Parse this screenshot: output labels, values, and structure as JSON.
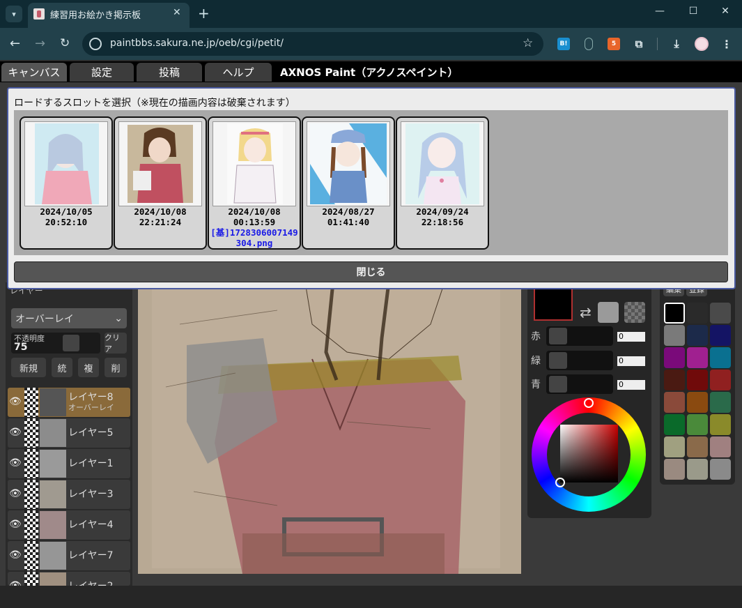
{
  "browser": {
    "tab_title": "練習用お絵かき掲示板",
    "url": "paintbbs.sakura.ne.jp/oeb/cgi/petit/",
    "icons": [
      "tab-search-icon",
      "close-icon",
      "new-tab-icon",
      "minimize-icon",
      "maximize-icon",
      "close-window-icon",
      "back-icon",
      "forward-icon",
      "reload-icon",
      "site-info-icon",
      "bookmark-star-icon",
      "hatena-bookmark-icon",
      "mouse-extension-icon",
      "html5-extension-icon",
      "puzzle-extensions-icon",
      "download-icon",
      "profile-avatar-icon",
      "kebab-menu-icon"
    ],
    "ext_hatena_label": "B!"
  },
  "app": {
    "menu": [
      "キャンバス",
      "設定",
      "投稿",
      "ヘルプ"
    ],
    "title": "AXNOS Paint（アクノスペイント）"
  },
  "modal": {
    "title": "ロードするスロットを選択（※現在の描画内容は破棄されます）",
    "close_label": "閉じる",
    "slots": [
      {
        "date": "2024/10/05",
        "time": "20:52:10",
        "file": ""
      },
      {
        "date": "2024/10/08",
        "time": "22:21:24",
        "file": ""
      },
      {
        "date": "2024/10/08",
        "time": "00:13:59",
        "file": "[基]1728306007149304.png"
      },
      {
        "date": "2024/08/27",
        "time": "01:41:40",
        "file": ""
      },
      {
        "date": "2024/09/24",
        "time": "22:18:56",
        "file": ""
      }
    ]
  },
  "layers_panel": {
    "header": "レイヤー",
    "blend_mode": "オーバーレイ",
    "opacity_label": "不透明度",
    "opacity_value": "75",
    "clear_label": "クリア",
    "buttons": [
      "新規",
      "統",
      "複",
      "削"
    ],
    "layers": [
      {
        "name": "レイヤー8",
        "sub": "オーバーレイ",
        "active": true
      },
      {
        "name": "レイヤー5",
        "sub": "",
        "active": false
      },
      {
        "name": "レイヤー1",
        "sub": "",
        "active": false
      },
      {
        "name": "レイヤー3",
        "sub": "",
        "active": false
      },
      {
        "name": "レイヤー4",
        "sub": "",
        "active": false
      },
      {
        "name": "レイヤー7",
        "sub": "",
        "active": false
      },
      {
        "name": "レイヤー2",
        "sub": "",
        "active": false
      }
    ]
  },
  "color_panel": {
    "red_label": "赤",
    "green_label": "緑",
    "blue_label": "青",
    "red_value": "0",
    "green_value": "0",
    "blue_value": "0",
    "current_color": "#000000"
  },
  "palette": {
    "tabs": [
      "編集",
      "登録"
    ],
    "colors": [
      "#000000",
      "#2a2a2a",
      "#4a4a4a",
      "#7a7a7a",
      "#1c2a4a",
      "#141464",
      "#7a0a7a",
      "#a02090",
      "#0a7090",
      "#4a1a12",
      "#700a0a",
      "#902020",
      "#8a4a3a",
      "#8a4a10",
      "#2a6a4a",
      "#0a6a2a",
      "#4a8a3a",
      "#8a8a2a",
      "#a0a080",
      "#8a6a4a",
      "#a08080",
      "#9a8a80",
      "#9a9a8a",
      "#8a8a8a"
    ]
  }
}
